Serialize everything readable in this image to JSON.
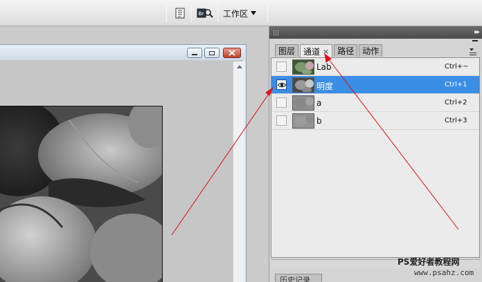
{
  "toolbar": {
    "workspace_label": "工作区",
    "icons": [
      "document-icon",
      "bridge-search-icon"
    ]
  },
  "panel": {
    "tabs": [
      {
        "label": "图层",
        "active": false
      },
      {
        "label": "通道",
        "active": true,
        "close": "×"
      },
      {
        "label": "路径",
        "active": false
      },
      {
        "label": "动作",
        "active": false
      }
    ],
    "channels": [
      {
        "name": "Lab",
        "shortcut": "Ctrl+~",
        "visible": false,
        "selected": false
      },
      {
        "name": "明度",
        "shortcut": "Ctrl+1",
        "visible": true,
        "selected": true
      },
      {
        "name": "a",
        "shortcut": "Ctrl+2",
        "visible": false,
        "selected": false
      },
      {
        "name": "b",
        "shortcut": "Ctrl+3",
        "visible": false,
        "selected": false
      }
    ],
    "history_tab": "历史记录"
  },
  "watermark": {
    "line1": "PS爱好者教程网",
    "line2": "www.psahz.com"
  },
  "colors": {
    "selection": "#3a8ee6",
    "annotation_arrow": "#e01010",
    "panel_bg": "#ebebeb"
  }
}
